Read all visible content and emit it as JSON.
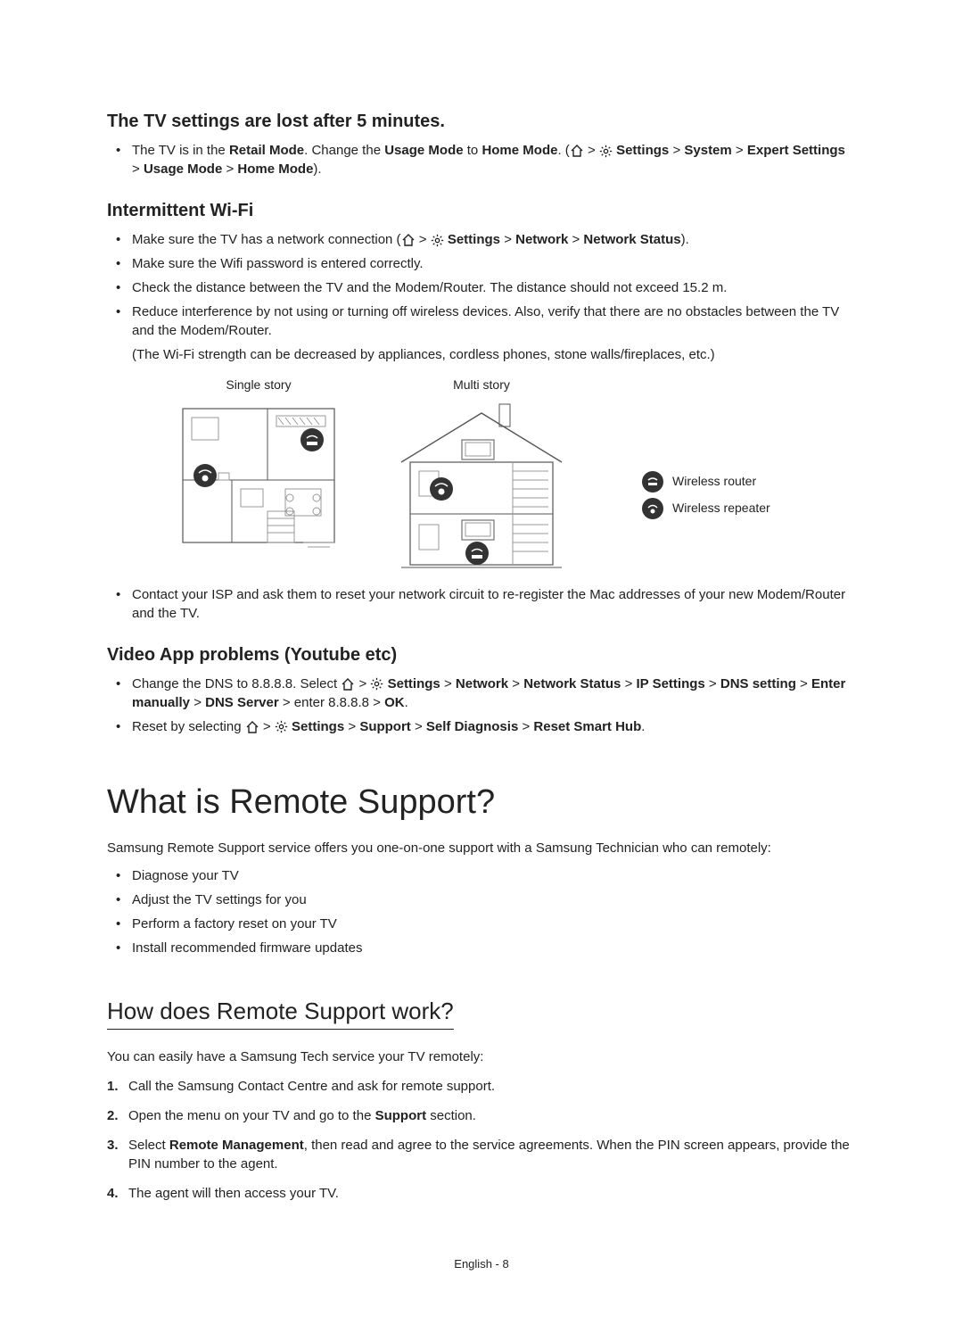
{
  "section1": {
    "heading": "The TV settings are lost after 5 minutes.",
    "bullets": [
      {
        "pre": "The TV is in the ",
        "b1": "Retail Mode",
        "mid1": ". Change the ",
        "b2": "Usage Mode",
        "mid2": " to ",
        "b3": "Home Mode",
        "mid3": ". (",
        "path1": "Settings",
        "path2": "System",
        "path3": "Expert Settings",
        "path4": "Usage Mode",
        "path5": "Home Mode",
        "end": ")."
      }
    ]
  },
  "section2": {
    "heading": "Intermittent Wi-Fi",
    "bullet1": {
      "pre": "Make sure the TV has a network connection (",
      "p1": "Settings",
      "p2": "Network",
      "p3": "Network Status",
      "end": ")."
    },
    "bullet2": "Make sure the Wifi password is entered correctly.",
    "bullet3": "Check the distance between the TV and the Modem/Router. The distance should not exceed 15.2 m.",
    "bullet4": "Reduce interference by not using or turning off wireless devices. Also, verify that there are no obstacles between the TV and the Modem/Router.",
    "bullet4_note": "(The Wi-Fi strength can be decreased by appliances, cordless phones, stone walls/fireplaces, etc.)",
    "diagram_single_label": "Single story",
    "diagram_multi_label": "Multi story",
    "legend_router": "Wireless router",
    "legend_repeater": "Wireless repeater",
    "bullet5": "Contact your ISP and ask them to reset your network circuit to re-register the Mac addresses of your new Modem/Router and the TV."
  },
  "section3": {
    "heading": "Video App problems (Youtube etc)",
    "bullet1": {
      "pre": "Change the DNS to 8.8.8.8. Select ",
      "p1": "Settings",
      "p2": "Network",
      "p3": "Network Status",
      "p4": "IP Settings",
      "p5": "DNS setting",
      "p6": "Enter manually",
      "p7": "DNS Server",
      "mid": " > enter 8.8.8.8 > ",
      "p8": "OK",
      "end": "."
    },
    "bullet2": {
      "pre": "Reset by selecting ",
      "p1": "Settings",
      "p2": "Support",
      "p3": "Self Diagnosis",
      "p4": "Reset Smart Hub",
      "end": "."
    }
  },
  "section4": {
    "heading": "What is Remote Support?",
    "intro": "Samsung Remote Support service offers you one-on-one support with a Samsung Technician who can remotely:",
    "bullets": [
      "Diagnose your TV",
      "Adjust the TV settings for you",
      "Perform a factory reset on your TV",
      "Install recommended firmware updates"
    ]
  },
  "section5": {
    "heading": "How does Remote Support work?",
    "intro": "You can easily have a Samsung Tech service your TV remotely:",
    "steps": {
      "s1": "Call the Samsung Contact Centre and ask for remote support.",
      "s2_pre": "Open the menu on your TV and go to the ",
      "s2_b": "Support",
      "s2_post": " section.",
      "s3_pre": "Select ",
      "s3_b": "Remote Management",
      "s3_post": ", then read and agree to the service agreements. When the PIN screen appears, provide the PIN number to the agent.",
      "s4": "The agent will then access your TV."
    }
  },
  "footer": "English - 8",
  "glyphs": {
    "chevron": ">"
  }
}
